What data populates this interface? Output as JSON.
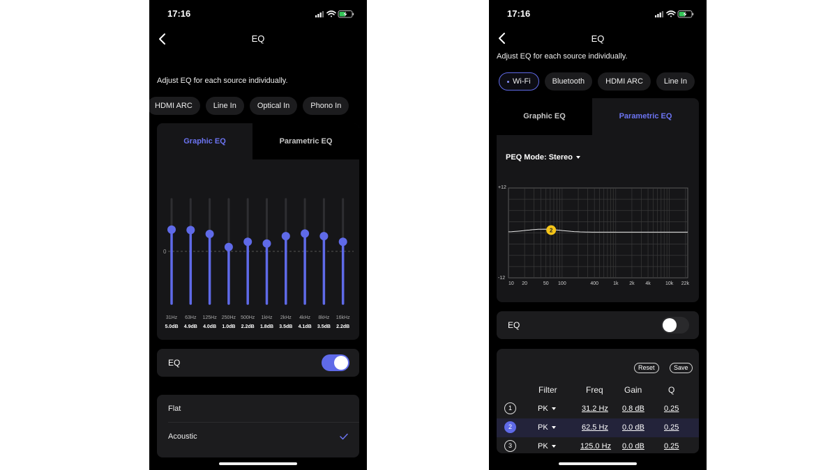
{
  "left_screen": {
    "status_time": "17:16",
    "title": "EQ",
    "subtitle": "Adjust EQ for each source individually.",
    "sources": [
      "HDMI ARC",
      "Line In",
      "Optical In",
      "Phono In"
    ],
    "tabs": {
      "graphic": "Graphic EQ",
      "parametric": "Parametric EQ",
      "active": "graphic"
    },
    "zero_label": "0",
    "bands": [
      {
        "freq": "31Hz",
        "gain_label": "5.0dB",
        "gain": 5.0
      },
      {
        "freq": "63Hz",
        "gain_label": "4.9dB",
        "gain": 4.9
      },
      {
        "freq": "125Hz",
        "gain_label": "4.0dB",
        "gain": 4.0
      },
      {
        "freq": "250Hz",
        "gain_label": "1.0dB",
        "gain": 1.0
      },
      {
        "freq": "500Hz",
        "gain_label": "2.2dB",
        "gain": 2.2
      },
      {
        "freq": "1kHz",
        "gain_label": "1.8dB",
        "gain": 1.8
      },
      {
        "freq": "2kHz",
        "gain_label": "3.5dB",
        "gain": 3.5
      },
      {
        "freq": "4kHz",
        "gain_label": "4.1dB",
        "gain": 4.1
      },
      {
        "freq": "8kHz",
        "gain_label": "3.5dB",
        "gain": 3.5
      },
      {
        "freq": "16kHz",
        "gain_label": "2.2dB",
        "gain": 2.2
      }
    ],
    "eq_label": "EQ",
    "eq_enabled": true,
    "presets": [
      {
        "label": "Flat",
        "selected": false
      },
      {
        "label": "Acoustic",
        "selected": true
      }
    ],
    "accent_color": "#5f6ae8"
  },
  "right_screen": {
    "status_time": "17:16",
    "title": "EQ",
    "subtitle": "Adjust EQ for each source individually.",
    "sources": [
      "Wi-Fi",
      "Bluetooth",
      "HDMI ARC",
      "Line In"
    ],
    "selected_source": "Wi-Fi",
    "tabs": {
      "graphic": "Graphic EQ",
      "parametric": "Parametric EQ",
      "active": "parametric"
    },
    "peq_mode": "PEQ Mode: Stereo",
    "graph": {
      "y_top_label": "+12",
      "y_bottom_label": "-12",
      "x_tick_labels": [
        "10",
        "20",
        "50",
        "100",
        "400",
        "1k",
        "2k",
        "4k",
        "10k",
        "22k"
      ],
      "marker_label": "2",
      "marker_color": "#f5c518"
    },
    "eq_label": "EQ",
    "eq_enabled": false,
    "reset_label": "Reset",
    "save_label": "Save",
    "table": {
      "headers": [
        "Filter",
        "Freq",
        "Gain",
        "Q"
      ],
      "rows": [
        {
          "num": "1",
          "filter": "PK",
          "freq": "31.2 Hz",
          "gain": "0.8 dB",
          "q": "0.25",
          "selected": false
        },
        {
          "num": "2",
          "filter": "PK",
          "freq": "62.5 Hz",
          "gain": "0.0 dB",
          "q": "0.25",
          "selected": true
        },
        {
          "num": "3",
          "filter": "PK",
          "freq": "125.0 Hz",
          "gain": "0.0 dB",
          "q": "0.25",
          "selected": false
        }
      ]
    }
  }
}
